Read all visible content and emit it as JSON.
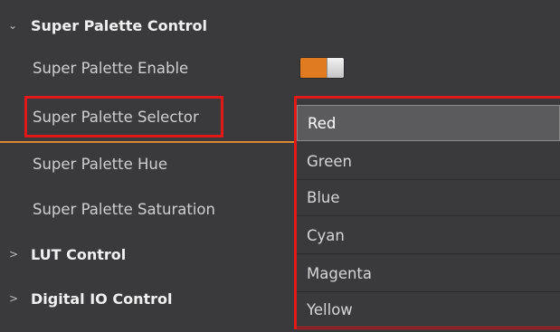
{
  "groups": {
    "super_palette": {
      "label": "Super Palette Control",
      "expanded": true
    },
    "lut": {
      "label": "LUT Control",
      "expanded": false
    },
    "digital_io": {
      "label": "Digital IO Control",
      "expanded": false
    }
  },
  "properties": {
    "enable": {
      "label": "Super Palette Enable",
      "value": "on"
    },
    "selector": {
      "label": "Super Palette Selector",
      "value": "Red"
    },
    "hue": {
      "label": "Super Palette Hue"
    },
    "saturation": {
      "label": "Super Palette Saturation"
    }
  },
  "dropdown": {
    "options": [
      "Red",
      "Green",
      "Blue",
      "Cyan",
      "Magenta",
      "Yellow"
    ],
    "selected": "Red"
  },
  "colors": {
    "panel_bg": "#3a3a3c",
    "toggle_on": "#e07c1f",
    "highlight": "#e01818",
    "separator": "#d98a30"
  },
  "icons": {
    "expanded": "chevron-down-icon",
    "collapsed": "chevron-right-icon"
  }
}
